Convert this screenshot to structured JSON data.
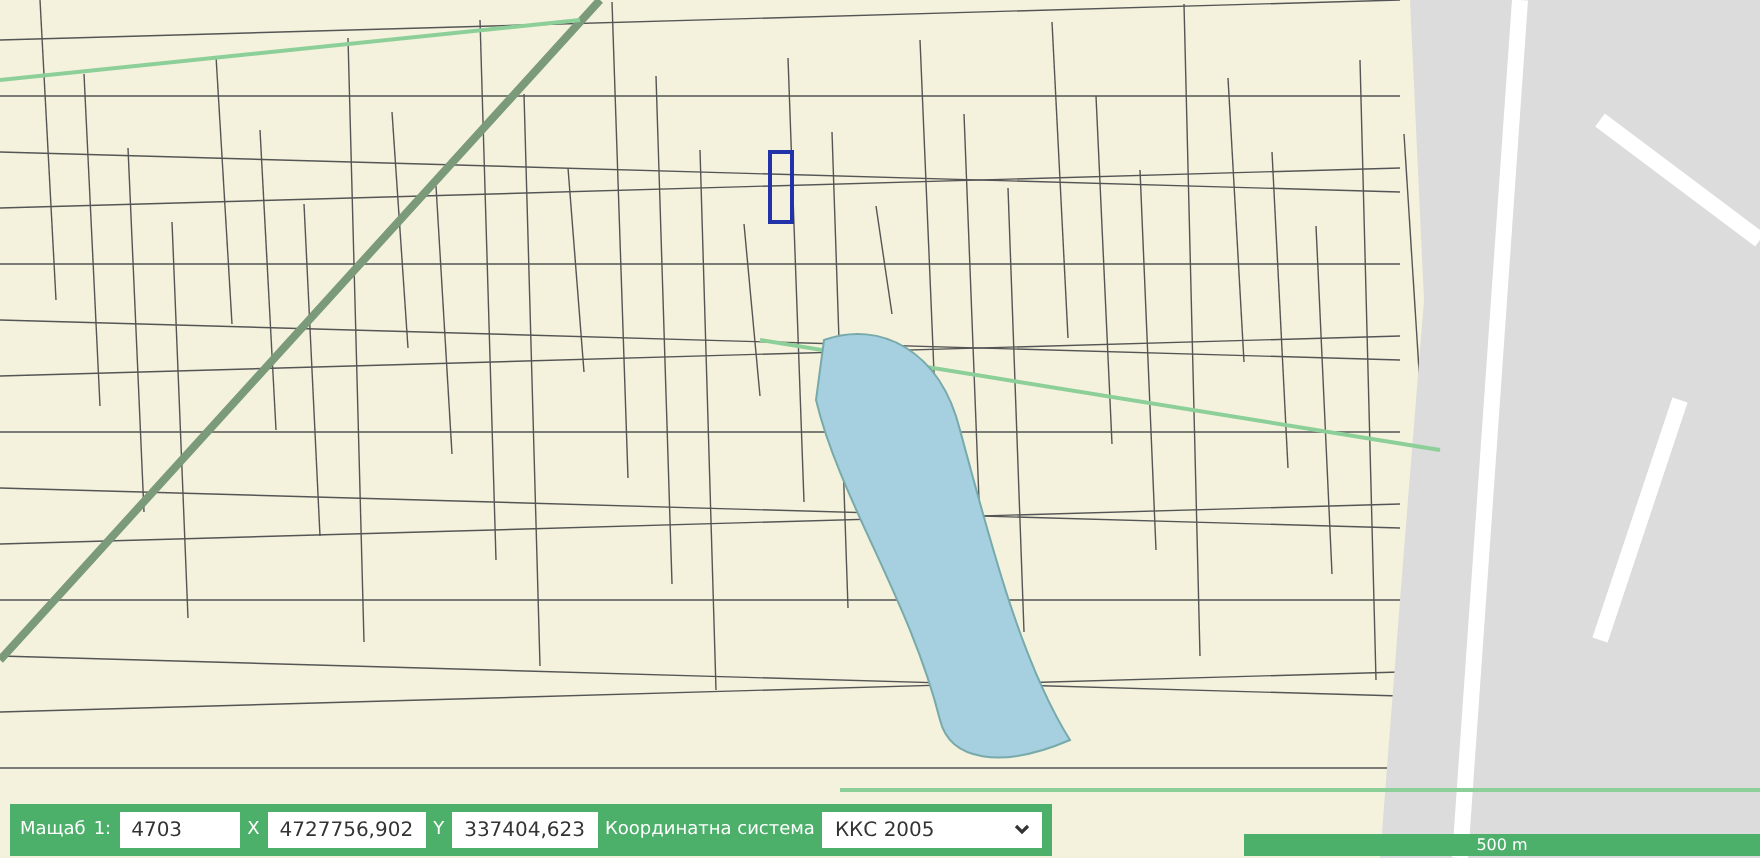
{
  "map": {
    "scale_bar": "500 m"
  },
  "toolbar": {
    "scale_label": "Мащаб",
    "scale_prefix": "1:",
    "scale_value": "4703",
    "x_label": "X",
    "x_value": "4727756,902",
    "y_label": "Y",
    "y_value": "337404,623",
    "crs_label": "Координатна система",
    "crs_value": "ККС 2005"
  }
}
